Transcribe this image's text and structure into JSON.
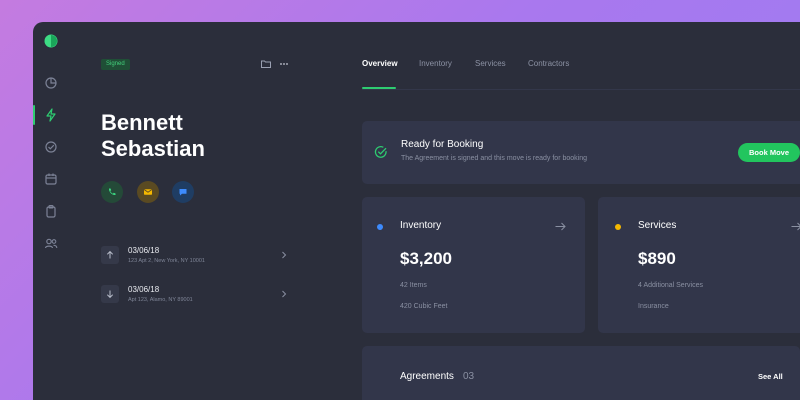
{
  "profile": {
    "status_badge": "Signed",
    "first_name": "Bennett",
    "last_name": "Sebastian"
  },
  "contacts": [
    "phone-icon",
    "mail-icon",
    "chat-icon"
  ],
  "moves": [
    {
      "direction": "up",
      "date": "03/06/18",
      "address": "123 Apt 2, New York, NY 10001"
    },
    {
      "direction": "down",
      "date": "03/06/18",
      "address": "Apt 123, Alamo, NY 89001"
    }
  ],
  "tabs": [
    {
      "label": "Overview",
      "active": true
    },
    {
      "label": "Inventory",
      "active": false
    },
    {
      "label": "Services",
      "active": false
    },
    {
      "label": "Contractors",
      "active": false
    }
  ],
  "booking": {
    "title": "Ready for Booking",
    "subtitle": "The Agreement is signed and this move is ready for booking",
    "button": "Book Move"
  },
  "inventory": {
    "title": "Inventory",
    "amount": "$3,200",
    "items": "42 Items",
    "volume": "420 Cubic Feet",
    "dot_color": "#3d8bfd"
  },
  "services": {
    "title": "Services",
    "amount": "$890",
    "detail": "4 Additional Services",
    "extra": "Insurance",
    "dot_color": "#f5b800"
  },
  "agreements": {
    "title": "Agreements",
    "count": "03",
    "link": "See All"
  },
  "colors": {
    "accent": "#22c55e",
    "panel": "#2b2e3b",
    "card": "#32364a"
  }
}
